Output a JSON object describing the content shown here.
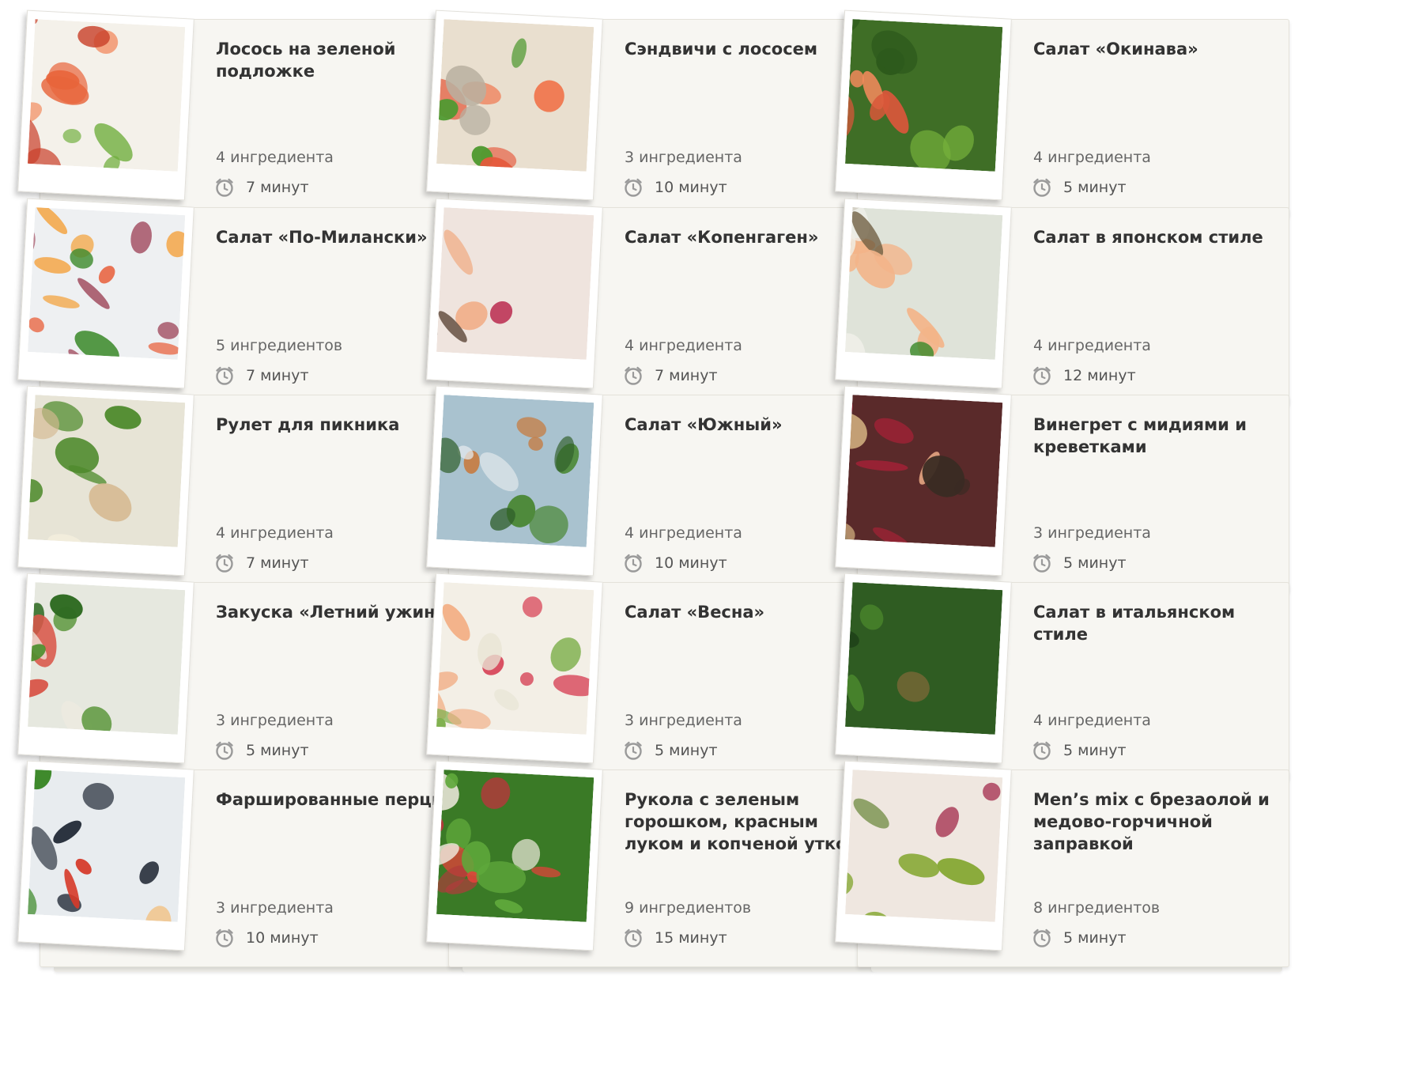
{
  "recipes": [
    {
      "title": "Лосось на зеленой подложке",
      "ingredients": "4 ингредиента",
      "time": "7 минут",
      "photo": "salmon-salad-photo",
      "palette": [
        "#f4f1ea",
        "#e8643a",
        "#f2875a",
        "#6fae3c",
        "#c9402a"
      ]
    },
    {
      "title": "Сэндвичи с лососем",
      "ingredients": "3 ингредиента",
      "time": "10 минут",
      "photo": "salmon-sandwich-photo",
      "palette": [
        "#e9dfcf",
        "#e55a3c",
        "#f07a52",
        "#4f9a31",
        "#b8b0a0"
      ]
    },
    {
      "title": "Салат «Окинава»",
      "ingredients": "4 ингредиента",
      "time": "5 минут",
      "photo": "okinawa-salad-photo",
      "palette": [
        "#3f6e26",
        "#d8573a",
        "#76b23b",
        "#2d5a1c",
        "#f28a5c"
      ]
    },
    {
      "title": "Салат «По-Милански»",
      "ingredients": "5 ингредиентов",
      "time": "7 минут",
      "photo": "milan-salad-photo",
      "palette": [
        "#eef0f2",
        "#e8603b",
        "#3f8b2e",
        "#f3a545",
        "#a0495d"
      ]
    },
    {
      "title": "Салат «Копенгаген»",
      "ingredients": "4 ингредиента",
      "time": "7 минут",
      "photo": "copenhagen-salad-photo",
      "palette": [
        "#efe4de",
        "#f1a87e",
        "#b8254a",
        "#5c8e3a",
        "#5a4535"
      ]
    },
    {
      "title": "Салат в японском стиле",
      "ingredients": "4 ингредиента",
      "time": "12 минут",
      "photo": "japanese-salad-photo",
      "palette": [
        "#dfe3d9",
        "#f3b489",
        "#3f8a2c",
        "#efefe8",
        "#6b5a3c"
      ]
    },
    {
      "title": "Рулет для пикника",
      "ingredients": "4 ингредиента",
      "time": "7 минут",
      "photo": "picnic-roll-photo",
      "palette": [
        "#e7e4d6",
        "#9cc25a",
        "#f2eddc",
        "#4e8a2c",
        "#d5b991"
      ]
    },
    {
      "title": "Салат «Южный»",
      "ingredients": "4 ингредиента",
      "time": "10 минут",
      "photo": "south-salad-photo",
      "palette": [
        "#a9c2cf",
        "#4f8a3c",
        "#e4eaed",
        "#c77a3e",
        "#2f5e2a"
      ]
    },
    {
      "title": "Винегрет с мидиями и креветками",
      "ingredients": "3 ингредиента",
      "time": "5 минут",
      "photo": "vinaigrette-mussels-photo",
      "palette": [
        "#5a2a2a",
        "#f0b089",
        "#9c2235",
        "#3a2b23",
        "#e0c08a"
      ]
    },
    {
      "title": "Закуска «Летний ужин»",
      "ingredients": "3 ингредиента",
      "time": "5 минут",
      "photo": "summer-dinner-photo",
      "palette": [
        "#e6e8df",
        "#4f8f2e",
        "#efeae0",
        "#d9574a",
        "#2f6b22"
      ]
    },
    {
      "title": "Салат «Весна»",
      "ingredients": "3 ингредиента",
      "time": "5 минут",
      "photo": "spring-salad-photo",
      "palette": [
        "#f3efe6",
        "#f2b087",
        "#7fb04e",
        "#e8e4d4",
        "#d84b5e"
      ]
    },
    {
      "title": "Салат в итальянском стиле",
      "ingredients": "4 ингредиента",
      "time": "5 минут",
      "photo": "italian-salad-photo",
      "palette": [
        "#2f5c22",
        "#4f8f2e",
        "#8b6a3c",
        "#e6e0c7",
        "#1e3f18"
      ]
    },
    {
      "title": "Фаршированные перцы",
      "ingredients": "3 ингредиента",
      "time": "10 минут",
      "photo": "stuffed-peppers-photo",
      "palette": [
        "#e8ecef",
        "#d63a2a",
        "#3f8a2c",
        "#2c3440",
        "#f1c48a"
      ]
    },
    {
      "title": "Рукола с зеленым горошком, красным луком и копченой уткой",
      "ingredients": "9 ингредиентов",
      "time": "15 минут",
      "photo": "arugula-duck-photo",
      "palette": [
        "#3a7a26",
        "#e6403a",
        "#5fa83b",
        "#efe9de",
        "#b03b3b"
      ]
    },
    {
      "title": "Men’s mix с брезаолой и медово-горчичной заправкой",
      "ingredients": "8 ингредиентов",
      "time": "5 минут",
      "photo": "bresaola-mix-photo",
      "palette": [
        "#efe7e0",
        "#a2294a",
        "#8aaa3a",
        "#faf3e6",
        "#5c7e2a"
      ]
    }
  ]
}
